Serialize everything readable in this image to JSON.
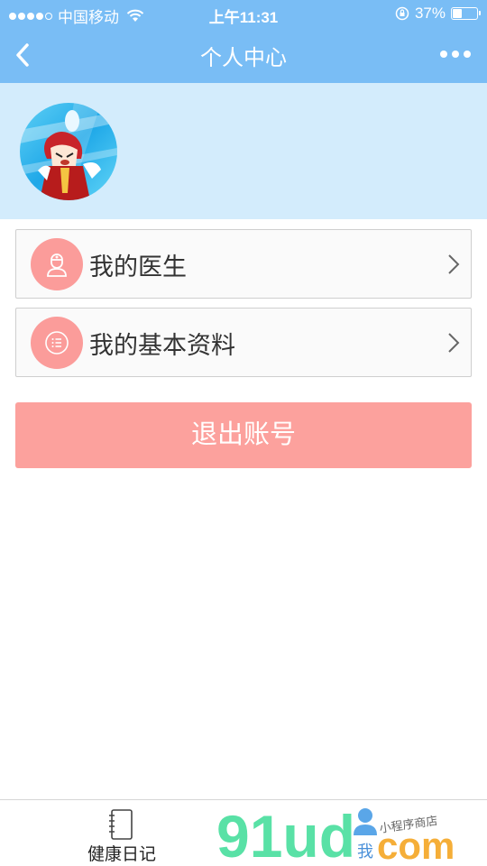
{
  "status_bar": {
    "carrier": "中国移动",
    "time": "上午11:31",
    "battery": "37%",
    "battery_level": 0.37
  },
  "nav": {
    "title": "个人中心",
    "back_icon": "chevron-left-icon",
    "more_icon": "more-dots-icon"
  },
  "profile": {
    "avatar_icon": "anime-avatar"
  },
  "menu": [
    {
      "label": "我的医生",
      "icon": "doctor-icon"
    },
    {
      "label": "我的基本资料",
      "icon": "list-icon"
    }
  ],
  "logout_label": "退出账号",
  "tab_bar": {
    "items": [
      {
        "label": "健康日记",
        "icon": "notebook-icon"
      }
    ]
  },
  "watermark": {
    "brand": "91ud",
    "suffix": "com",
    "wo": "我",
    "slogan": "小程序商店"
  },
  "colors": {
    "nav_bg": "#79bdf5",
    "header_bg": "#d3ecfc",
    "accent_pink": "#fb9c9a",
    "logout_bg": "#fca19d"
  }
}
